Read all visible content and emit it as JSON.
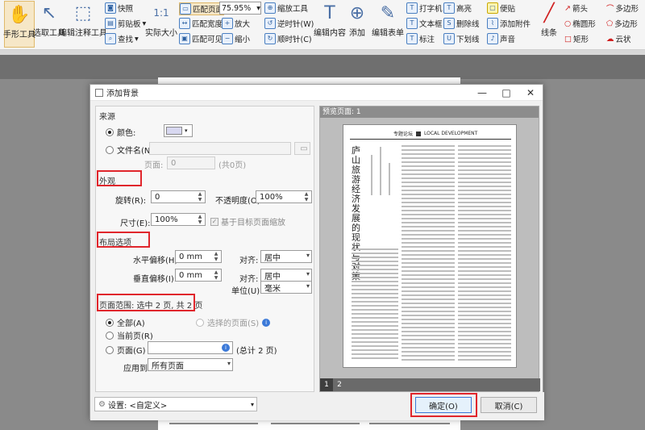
{
  "toolbar": {
    "hand_tool": "手形工具",
    "select_tool": "选取工具",
    "edit_annot": "编辑注释工具",
    "snapshot": "快照",
    "clipboard": "剪贴板",
    "find": "查找",
    "actual_size": "实际大小",
    "fit_page": "匹配页面",
    "fit_width": "匹配宽度",
    "fit_visible": "匹配可见",
    "zoom_value": "75.95%",
    "zoom_tool": "缩放工具",
    "zoom_in": "放大",
    "zoom_out": "缩小",
    "rotate_ccw": "逆时针(W)",
    "rotate_cw": "顺时针(C)",
    "edit_content": "编辑内容",
    "add": "添加",
    "edit_form": "编辑表单",
    "typewriter": "打字机",
    "textbox": "文本框",
    "callout": "标注",
    "highlight": "高亮",
    "strikeout": "删除线",
    "underline": "下划线",
    "sticky_note": "便贴",
    "attach_file": "添加附件",
    "sound": "声音",
    "line": "线条",
    "arrow": "箭头",
    "ellipse": "椭圆形",
    "rectangle": "矩形",
    "polygon_line": "多边形",
    "polygon": "多边形",
    "cloud": "云状"
  },
  "dialog": {
    "title": "添加背景",
    "source_label": "来源",
    "color_label": "颜色:",
    "color_value": "#d8d8f0",
    "file_label": "文件名(N):",
    "page_label": "页面:",
    "page_value": "0",
    "page_total": "(共0页)",
    "appearance_label": "外观",
    "rotate_label": "旋转(R):",
    "rotate_value": "0",
    "opacity_label": "不透明度(O):",
    "opacity_value": "100%",
    "size_label": "尺寸(E):",
    "size_value": "100%",
    "scale_label": "基于目标页面缩放",
    "layout_label": "布局选项",
    "hoffset_label": "水平偏移(H):",
    "hoffset_value": "0 mm",
    "voffset_label": "垂直偏移(I):",
    "voffset_value": "0 mm",
    "align_label": "对齐:",
    "halign_value": "居中",
    "valign_value": "居中",
    "unit_label": "单位(U):",
    "unit_value": "毫米",
    "range_label": "页面范围: 选中 2 页, 共 2 页",
    "all_label": "全部(A)",
    "selected_label": "选择的页面(S)",
    "current_label": "当前页(R)",
    "pages_label": "页面(G)",
    "pages_total": "(总计 2 页)",
    "apply_label": "应用到:",
    "apply_value": "所有页面",
    "preview_label": "预览页面: 1",
    "page_tabs": [
      "1",
      "2"
    ],
    "settings_label": "设置: <自定义>",
    "ok_label": "确定(O)",
    "cancel_label": "取消(C)"
  },
  "preview_doc": {
    "header_left": "专题论坛",
    "header_right": "LOCAL DEVELOPMENT",
    "title": "庐山旅游经济发展的现状与对策"
  },
  "colors": {
    "highlight_box": "#e0262c",
    "accent": "#3b79d8"
  }
}
